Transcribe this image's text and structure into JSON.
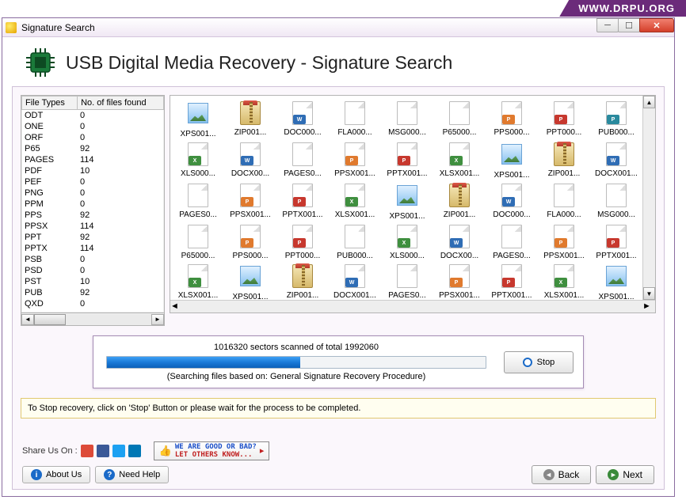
{
  "ribbon": {
    "url": "WWW.DRPU.ORG"
  },
  "window": {
    "title": "Signature Search"
  },
  "header": {
    "title": "USB Digital Media Recovery - Signature Search"
  },
  "file_table": {
    "col_types": "File Types",
    "col_count": "No. of files found",
    "rows": [
      {
        "type": "ODT",
        "count": "0"
      },
      {
        "type": "ONE",
        "count": "0"
      },
      {
        "type": "ORF",
        "count": "0"
      },
      {
        "type": "P65",
        "count": "92"
      },
      {
        "type": "PAGES",
        "count": "114"
      },
      {
        "type": "PDF",
        "count": "10"
      },
      {
        "type": "PEF",
        "count": "0"
      },
      {
        "type": "PNG",
        "count": "0"
      },
      {
        "type": "PPM",
        "count": "0"
      },
      {
        "type": "PPS",
        "count": "92"
      },
      {
        "type": "PPSX",
        "count": "114"
      },
      {
        "type": "PPT",
        "count": "92"
      },
      {
        "type": "PPTX",
        "count": "114"
      },
      {
        "type": "PSB",
        "count": "0"
      },
      {
        "type": "PSD",
        "count": "0"
      },
      {
        "type": "PST",
        "count": "10"
      },
      {
        "type": "PUB",
        "count": "92"
      },
      {
        "type": "QXD",
        "count": "0"
      }
    ]
  },
  "icon_grid": {
    "rows": [
      [
        {
          "label": "XPS001...",
          "kind": "img"
        },
        {
          "label": "ZIP001...",
          "kind": "zip"
        },
        {
          "label": "DOC000...",
          "kind": "doc",
          "badge": "W",
          "cls": "b-blue"
        },
        {
          "label": "FLA000...",
          "kind": "page"
        },
        {
          "label": "MSG000...",
          "kind": "page"
        },
        {
          "label": "P65000...",
          "kind": "page"
        },
        {
          "label": "PPS000...",
          "kind": "doc",
          "badge": "P",
          "cls": "b-orange"
        },
        {
          "label": "PPT000...",
          "kind": "doc",
          "badge": "P",
          "cls": "b-red"
        },
        {
          "label": "PUB000...",
          "kind": "doc",
          "badge": "P",
          "cls": "b-teal"
        }
      ],
      [
        {
          "label": "XLS000...",
          "kind": "doc",
          "badge": "X",
          "cls": "b-green"
        },
        {
          "label": "DOCX00...",
          "kind": "doc",
          "badge": "W",
          "cls": "b-blue"
        },
        {
          "label": "PAGES0...",
          "kind": "page"
        },
        {
          "label": "PPSX001...",
          "kind": "doc",
          "badge": "P",
          "cls": "b-orange"
        },
        {
          "label": "PPTX001...",
          "kind": "doc",
          "badge": "P",
          "cls": "b-red"
        },
        {
          "label": "XLSX001...",
          "kind": "doc",
          "badge": "X",
          "cls": "b-green"
        },
        {
          "label": "XPS001...",
          "kind": "img"
        },
        {
          "label": "ZIP001...",
          "kind": "zip"
        },
        {
          "label": "DOCX001...",
          "kind": "doc",
          "badge": "W",
          "cls": "b-blue"
        }
      ],
      [
        {
          "label": "PAGES0...",
          "kind": "page"
        },
        {
          "label": "PPSX001...",
          "kind": "doc",
          "badge": "P",
          "cls": "b-orange"
        },
        {
          "label": "PPTX001...",
          "kind": "doc",
          "badge": "P",
          "cls": "b-red"
        },
        {
          "label": "XLSX001...",
          "kind": "doc",
          "badge": "X",
          "cls": "b-green"
        },
        {
          "label": "XPS001...",
          "kind": "img"
        },
        {
          "label": "ZIP001...",
          "kind": "zip"
        },
        {
          "label": "DOC000...",
          "kind": "doc",
          "badge": "W",
          "cls": "b-blue"
        },
        {
          "label": "FLA000...",
          "kind": "page"
        },
        {
          "label": "MSG000...",
          "kind": "page"
        }
      ],
      [
        {
          "label": "P65000...",
          "kind": "page"
        },
        {
          "label": "PPS000...",
          "kind": "doc",
          "badge": "P",
          "cls": "b-orange"
        },
        {
          "label": "PPT000...",
          "kind": "doc",
          "badge": "P",
          "cls": "b-red"
        },
        {
          "label": "PUB000...",
          "kind": "page"
        },
        {
          "label": "XLS000...",
          "kind": "doc",
          "badge": "X",
          "cls": "b-green"
        },
        {
          "label": "DOCX00...",
          "kind": "doc",
          "badge": "W",
          "cls": "b-blue"
        },
        {
          "label": "PAGES0...",
          "kind": "page"
        },
        {
          "label": "PPSX001...",
          "kind": "doc",
          "badge": "P",
          "cls": "b-orange"
        },
        {
          "label": "PPTX001...",
          "kind": "doc",
          "badge": "P",
          "cls": "b-red"
        }
      ],
      [
        {
          "label": "XLSX001...",
          "kind": "doc",
          "badge": "X",
          "cls": "b-green"
        },
        {
          "label": "XPS001...",
          "kind": "img"
        },
        {
          "label": "ZIP001...",
          "kind": "zip"
        },
        {
          "label": "DOCX001...",
          "kind": "doc",
          "badge": "W",
          "cls": "b-blue"
        },
        {
          "label": "PAGES0...",
          "kind": "page"
        },
        {
          "label": "PPSX001...",
          "kind": "doc",
          "badge": "P",
          "cls": "b-orange"
        },
        {
          "label": "PPTX001...",
          "kind": "doc",
          "badge": "P",
          "cls": "b-red"
        },
        {
          "label": "XLSX001...",
          "kind": "doc",
          "badge": "X",
          "cls": "b-green"
        },
        {
          "label": "XPS001...",
          "kind": "img"
        }
      ]
    ]
  },
  "progress": {
    "status_line": "1016320 sectors scanned of total 1992060",
    "percent": 51,
    "mode_line": "(Searching files based on:  General Signature Recovery Procedure)",
    "stop_label": "Stop"
  },
  "hint": {
    "text": "To Stop recovery, click on 'Stop' Button or please wait for the process to be completed."
  },
  "share": {
    "label": "Share Us On :",
    "rate_top": "WE ARE GOOD OR BAD?",
    "rate_bot": "LET OTHERS KNOW..."
  },
  "nav": {
    "about": "About Us",
    "help": "Need Help",
    "back": "Back",
    "next": "Next"
  }
}
